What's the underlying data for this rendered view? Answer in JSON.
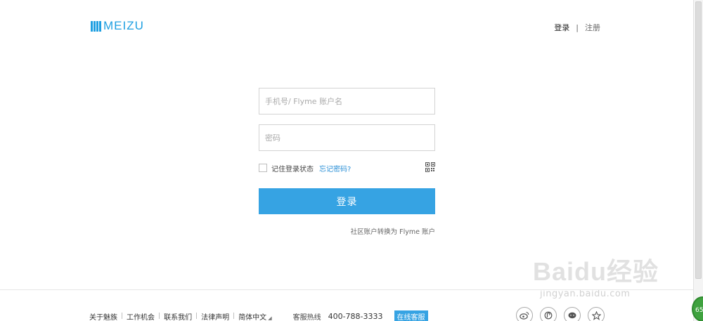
{
  "header": {
    "logo_text": "MEIZU",
    "login_label": "登录",
    "separator": "|",
    "register_label": "注册"
  },
  "form": {
    "account_placeholder": "手机号/ Flyme 账户名",
    "account_value": "",
    "password_placeholder": "密码",
    "password_value": "",
    "remember_label": "记住登录状态",
    "remember_checked": false,
    "forgot_label": "忘记密码?",
    "submit_label": "登录",
    "convert_label": "社区账户转换为 Flyme 账户"
  },
  "footer": {
    "links": [
      "关于魅族",
      "工作机会",
      "联系我们",
      "法律声明",
      "简体中文"
    ],
    "hotline_label": "客服热线",
    "hotline_number": "400-788-3333",
    "online_service_label": "在线客服",
    "socials": [
      "weibo-icon",
      "flyme-icon",
      "wechat-icon",
      "star-icon"
    ]
  },
  "watermark": {
    "text": "Baidu经验",
    "sub": "jingyan.baidu.com"
  },
  "badge": {
    "text": "65"
  },
  "colors": {
    "brand_blue": "#1e9fe1",
    "button_blue": "#36a3e3",
    "link_blue": "#2a8fd6"
  }
}
